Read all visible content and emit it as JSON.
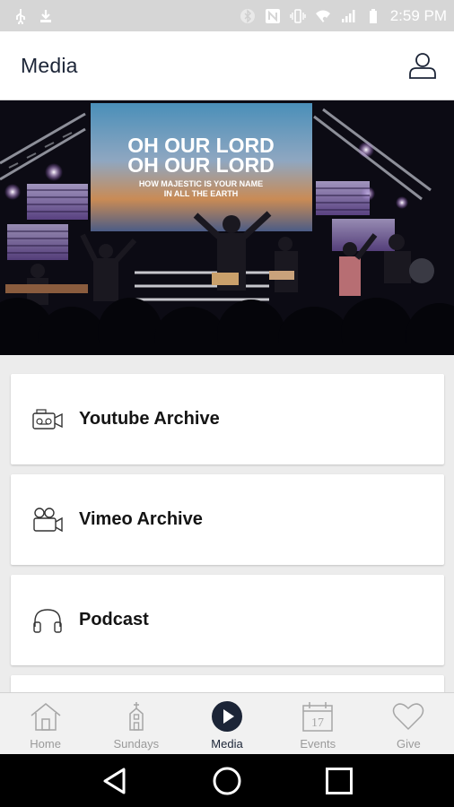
{
  "status_bar": {
    "time": "2:59 PM",
    "icons": [
      "usb-icon",
      "download-icon",
      "bluetooth-icon",
      "nfc-icon",
      "vibrate-icon",
      "wifi-icon",
      "signal-icon",
      "battery-icon"
    ]
  },
  "header": {
    "title": "Media",
    "profile_icon": "person-icon"
  },
  "hero": {
    "screen_line1": "OH OUR LORD",
    "screen_line2": "OH OUR LORD",
    "screen_line3": "HOW MAJESTIC IS YOUR NAME",
    "screen_line4": "IN ALL THE EARTH"
  },
  "menu": {
    "items": [
      {
        "label": "Youtube Archive",
        "icon": "video-camera-icon"
      },
      {
        "label": "Vimeo Archive",
        "icon": "movie-camera-icon"
      },
      {
        "label": "Podcast",
        "icon": "headphones-icon"
      }
    ]
  },
  "tabs": [
    {
      "label": "Home",
      "icon": "home-icon",
      "active": false
    },
    {
      "label": "Sundays",
      "icon": "church-icon",
      "active": false
    },
    {
      "label": "Media",
      "icon": "play-icon",
      "active": true
    },
    {
      "label": "Events",
      "icon": "calendar-icon",
      "active": false,
      "day": "17"
    },
    {
      "label": "Give",
      "icon": "heart-icon",
      "active": false
    }
  ],
  "colors": {
    "accent": "#1c2537",
    "inactive": "#9a9a9a",
    "status_bar": "#d6d6d6"
  }
}
